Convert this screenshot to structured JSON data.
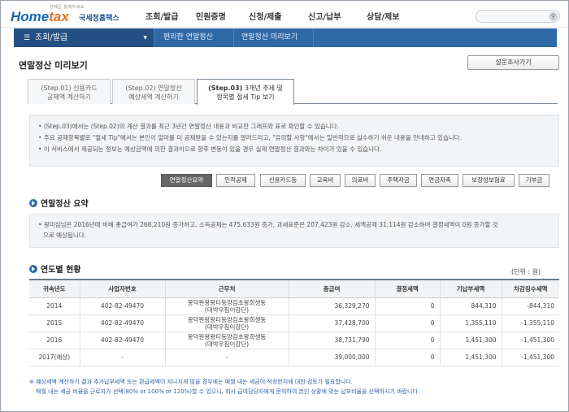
{
  "header": {
    "logo_tagline": "언제든 함께하세요",
    "logo_home": "Home",
    "logo_tax": "tax",
    "logo_sub": "국세청홈택스",
    "gnb": [
      "조회/발급",
      "민원증명",
      "신청/제출",
      "신고/납부",
      "상담/제보"
    ],
    "search_placeholder": ""
  },
  "navbar": {
    "home_label": "조회/발급",
    "crumbs": [
      "편리한 연말정산",
      "연말정산 미리보기"
    ]
  },
  "page": {
    "title": "연말정산 미리보기",
    "survey_button": "설문조사가기"
  },
  "tabs": [
    {
      "step": "(Step.01)",
      "line1": "신용카드",
      "line2": "공제액 계산하기",
      "active": false
    },
    {
      "step": "(Step.02)",
      "line1": "연말정산",
      "line2": "예상세액 계산하기",
      "active": false
    },
    {
      "step": "(Step.03)",
      "line1": "3개년 추세 및",
      "line2": "항목별 절세 Tip 보기",
      "active": true
    }
  ],
  "info": [
    "(Step.03)에서는 (Step.02)의 계산 결과를 최근 3년간 연말정산 내용과 비교한 그래프와 표로 확인할 수 있습니다.",
    "주요 공제항목별로 \"절세 Tip\"에서는 본인이 얼마를 더 공제받을 수 있는지를 알려드리고, \"유의할 사항\"에서는 일반적으로 실수하기 쉬운 내용을 안내하고 있습니다.",
    "이 서비스에서 제공되는 정보는 예상금액에 의한 결과이므로 향후 변동이 있을 경우 실제 연말정산 결과와는 차이가 있을 수 있습니다."
  ],
  "categories": [
    "연말정산요약",
    "인적공제",
    "신용카드등",
    "교육비",
    "의료비",
    "주택자금",
    "연금저축",
    "보장성보험료",
    "기부금"
  ],
  "summary": {
    "title": "연말정산 요약",
    "text_line1": "왕미심님은 2016년에 비해 총급여가 268,210원 증가하고, 소득공제는 475,633원 증가, 과세표준은 207,423원 감소, 세액공제 31,114원 감소하여 결정세액이 0원 증가할 것",
    "text_line2": "으로 예상됩니다."
  },
  "yearly": {
    "title": "연도별 현황",
    "unit": "(단위 : 원)",
    "columns": [
      "귀속년도",
      "사업자번호",
      "근무처",
      "총급여",
      "결정세액",
      "기납부세액",
      "차감징수세액"
    ],
    "rows": [
      {
        "year": "2014",
        "biz_no": "402-82-49470",
        "workplace_1": "봉덕판왕왕티동양김초왕희생동",
        "workplace_2": "(대박우침이강단)",
        "gross": "36,329,270",
        "decided": "0",
        "prepaid": "844,310",
        "diff": "-844,310"
      },
      {
        "year": "2015",
        "biz_no": "402-82-49470",
        "workplace_1": "봉덕판왕왕티동양김초왕희생동",
        "workplace_2": "(대박우침이강단)",
        "gross": "37,428,700",
        "decided": "0",
        "prepaid": "1,355,110",
        "diff": "-1,355,110"
      },
      {
        "year": "2016",
        "biz_no": "402-82-49470",
        "workplace_1": "봉덕판왕왕티동양김초왕희생동",
        "workplace_2": "(대박우침이강단)",
        "gross": "38,731,790",
        "decided": "0",
        "prepaid": "1,451,300",
        "diff": "-1,451,300"
      },
      {
        "year": "2017(예상)",
        "biz_no": "-",
        "workplace_1": "-",
        "workplace_2": "",
        "gross": "39,000,000",
        "decided": "0",
        "prepaid": "1,451,300",
        "diff": "-1,451,300"
      }
    ]
  },
  "footnote": {
    "line1": "※ 예상세액 계산하기 결과 추가납부세액 또는 환급세액이 지나치게 많을 경우에는 매월 내는 세금이 적정한지에 대한 검토가 필요합니다.",
    "line2": "매월 내는 세금 비율을 근로자가 선택(80% or 100% or 120%)할 수 있으니, 회사 급여담당자에게 문의하여 본인 상황에 맞는 납부비율을 선택하시기 바랍니다."
  }
}
